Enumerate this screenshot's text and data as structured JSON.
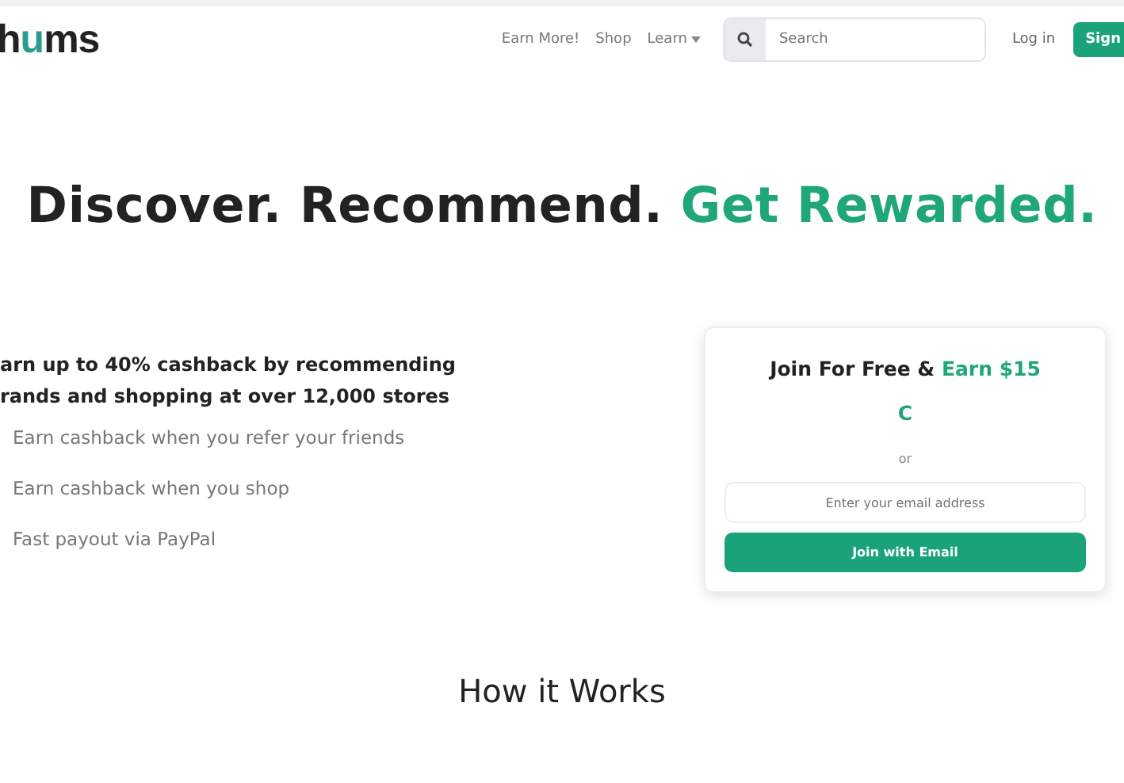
{
  "nav": {
    "logo": {
      "before": "h",
      "accent": "u",
      "after": "ms"
    },
    "links": [
      {
        "label": "Earn More!",
        "kind": "link"
      },
      {
        "label": "Shop",
        "kind": "link"
      },
      {
        "label": "Learn",
        "kind": "dropdown"
      }
    ],
    "search": {
      "placeholder": "Search"
    },
    "login": "Log in",
    "signup": "Sign"
  },
  "hero": {
    "heading": "Discover. Recommend.",
    "heading_accent": "Get Rewarded."
  },
  "pitch": {
    "lines": [
      "arn up to 40% cashback by recommending",
      "rands and shopping at over 12,000 stores"
    ],
    "benefits": [
      "Earn cashback when you refer your friends",
      "Earn cashback when you shop",
      "Fast payout via PayPal"
    ]
  },
  "signup_card": {
    "title": "Join For Free &",
    "title_accent": "Earn $15",
    "title_accent_2": "C",
    "divider": "or",
    "email": {
      "placeholder": "Enter your email address"
    },
    "button": "Join with Email"
  },
  "section_title": "How it Works"
}
